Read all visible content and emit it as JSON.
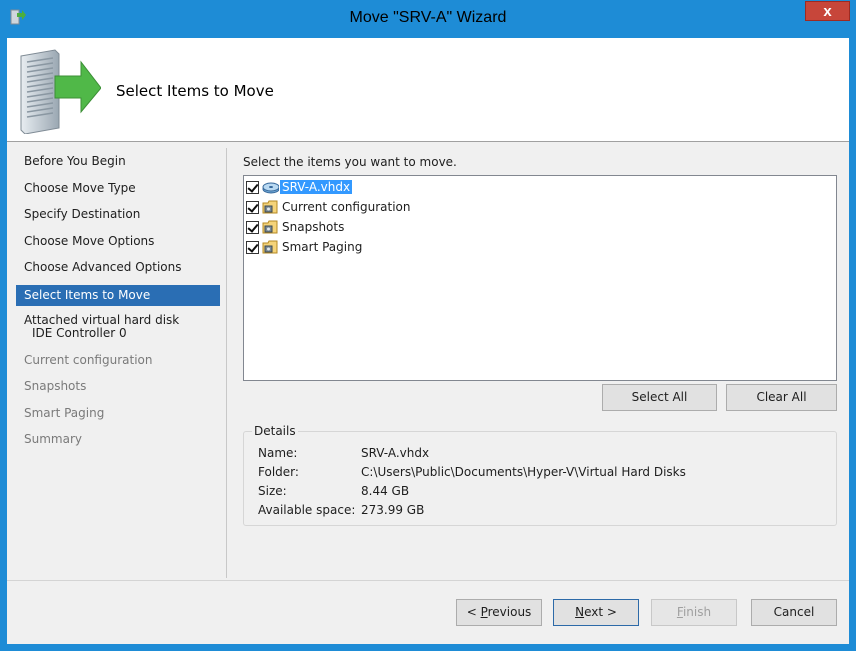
{
  "window": {
    "title": "Move \"SRV-A\" Wizard",
    "close_label": "x"
  },
  "header": {
    "title": "Select Items to Move"
  },
  "nav": {
    "items": [
      {
        "label": "Before You Begin"
      },
      {
        "label": "Choose Move Type"
      },
      {
        "label": "Specify Destination"
      },
      {
        "label": "Choose Move Options"
      },
      {
        "label": "Choose Advanced Options"
      },
      {
        "label": "Select Items to Move"
      },
      {
        "label": "Attached virtual hard disk",
        "sublabel": "IDE Controller 0"
      },
      {
        "label": "Current configuration"
      },
      {
        "label": "Snapshots"
      },
      {
        "label": "Smart Paging"
      },
      {
        "label": "Summary"
      }
    ]
  },
  "main": {
    "instruction": "Select the items you want to move.",
    "items": [
      {
        "label": "SRV-A.vhdx",
        "checked": true,
        "icon": "disk-icon"
      },
      {
        "label": "Current configuration",
        "checked": true,
        "icon": "folder-icon"
      },
      {
        "label": "Snapshots",
        "checked": true,
        "icon": "folder-icon"
      },
      {
        "label": "Smart Paging",
        "checked": true,
        "icon": "folder-icon"
      }
    ],
    "select_all_label": "Select All",
    "clear_all_label": "Clear All"
  },
  "details": {
    "legend": "Details",
    "name_label": "Name:",
    "name_value": "SRV-A.vhdx",
    "folder_label": "Folder:",
    "folder_value": "C:\\Users\\Public\\Documents\\Hyper-V\\Virtual Hard Disks",
    "size_label": "Size:",
    "size_value": "8.44 GB",
    "space_label": "Available space:",
    "space_value": "273.99 GB"
  },
  "footer": {
    "previous_prefix": "< ",
    "previous_accel": "P",
    "previous_rest": "revious",
    "next_accel": "N",
    "next_rest": "ext >",
    "finish_accel": "F",
    "finish_rest": "inish",
    "cancel_label": "Cancel"
  },
  "colors": {
    "title_bar": "#1e8cd6",
    "selection": "#2a6eb4",
    "close_button": "#c7463a"
  }
}
